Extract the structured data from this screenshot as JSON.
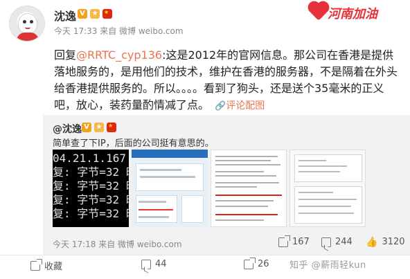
{
  "post": {
    "username": "沈逸",
    "badges": [
      "V",
      "🍊"
    ],
    "time": "今天 17:33 来自 微博 weibo.com",
    "logo_text": "河南加油",
    "body": {
      "prefix": "回复",
      "mention": "@RRTC_cyp136",
      "text": ":这是2012年的官网信息。那公司在香港是提供落地服务的，是用他们的技术，维护在香港的服务器，不是隔着在外头给香港提供服务的。所以。。。。看到了狗头，还是送个35毫米的正义吧，放心，装药量酌情减了点。",
      "link_icon": "🔗",
      "link_label": "评论配图"
    }
  },
  "repost": {
    "user": "@沈逸",
    "text": "简单查了下IP，后面的公司挺有意思的。",
    "terminal_lines": [
      "04.21.1.167",
      "复: 字节=32 时",
      "复: 字节=32 时",
      "复: 字节=32 时",
      "复: 字节=32 时"
    ],
    "time": "今天 17:18 来自 微博 weibo.com",
    "stats": {
      "shares": "167",
      "comments": "244",
      "likes": "3120"
    }
  },
  "footer": {
    "shares": "收藏",
    "comments": "44",
    "reposts": "26",
    "watermark": "知乎 @薪雨轻kun"
  },
  "colors": {
    "mention": "#eb7350",
    "repost_bg": "#f2f2f5"
  }
}
